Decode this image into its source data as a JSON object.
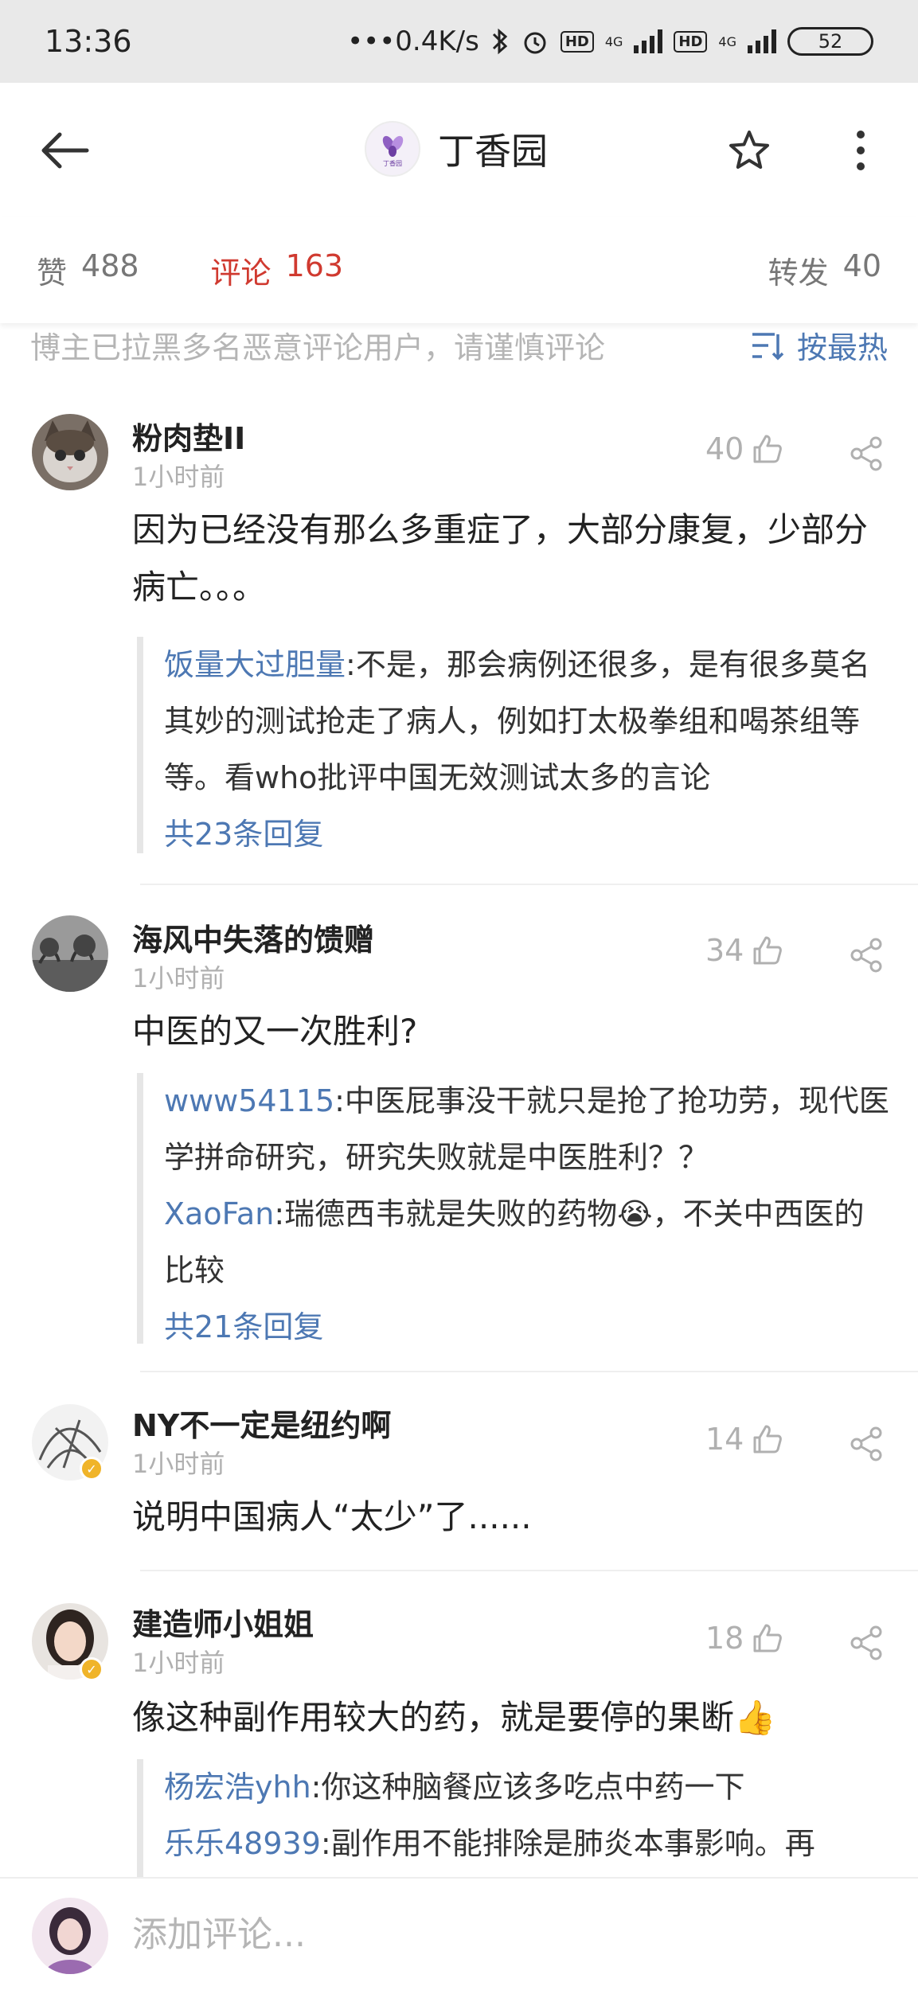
{
  "status_bar": {
    "time": "13:36",
    "network_speed": "•••0.4K/s",
    "hd1": "HD",
    "hd2": "HD",
    "net1": "4G",
    "net2": "4G",
    "battery": "52"
  },
  "header": {
    "title": "丁香园",
    "logo_text": "丁香园",
    "back_icon": "arrow-left-icon",
    "star_icon": "star-icon",
    "more_icon": "more-vertical-icon"
  },
  "tabs": {
    "likes_label": "赞",
    "likes_count": "488",
    "comments_label": "评论",
    "comments_count": "163",
    "forward_label": "转发",
    "forward_count": "40"
  },
  "notice": {
    "text": "博主已拉黑多名恶意评论用户，请谨慎评论",
    "sort_label": "按最热"
  },
  "comments": [
    {
      "name": "粉肉垫II",
      "time": "1小时前",
      "likes": "40",
      "text": "因为已经没有那么多重症了，大部分康复，少部分病亡。。。",
      "replies": [
        {
          "user": "饭量大过胆量",
          "text": ":不是，那会病例还很多，是有很多莫名其妙的测试抢走了病人，例如打太极拳组和喝茶组等等。看who批评中国无效测试太多的言论"
        }
      ],
      "total_replies": "共23条回复"
    },
    {
      "name": "海风中失落的馈赠",
      "time": "1小时前",
      "likes": "34",
      "text": "中医的又一次胜利?",
      "replies": [
        {
          "user": "www54115",
          "text": ":中医屁事没干就只是抢了抢功劳，现代医学拼命研究，研究失败就是中医胜利？？"
        },
        {
          "user": "XaoFan",
          "text": ":瑞德西韦就是失败的药物😭，不关中西医的比较"
        }
      ],
      "total_replies": "共21条回复"
    },
    {
      "name": "NY不一定是纽约啊",
      "time": "1小时前",
      "likes": "14",
      "text": "说明中国病人“太少”了......"
    },
    {
      "name": "建造师小姐姐",
      "time": "1小时前",
      "likes": "18",
      "text": "像这种副作用较大的药，就是要停的果断👍",
      "replies": [
        {
          "user": "杨宏浩yhh",
          "text": ":你这种脑餐应该多吃点中药一下"
        },
        {
          "user": "乐乐48939",
          "text": ":副作用不能排除是肺炎本事影响。再"
        }
      ]
    }
  ],
  "bottom": {
    "placeholder": "添加评论..."
  },
  "colors": {
    "accent_red": "#d03a30",
    "link_blue": "#4d78b3",
    "muted_gray": "#b0b0b0"
  }
}
